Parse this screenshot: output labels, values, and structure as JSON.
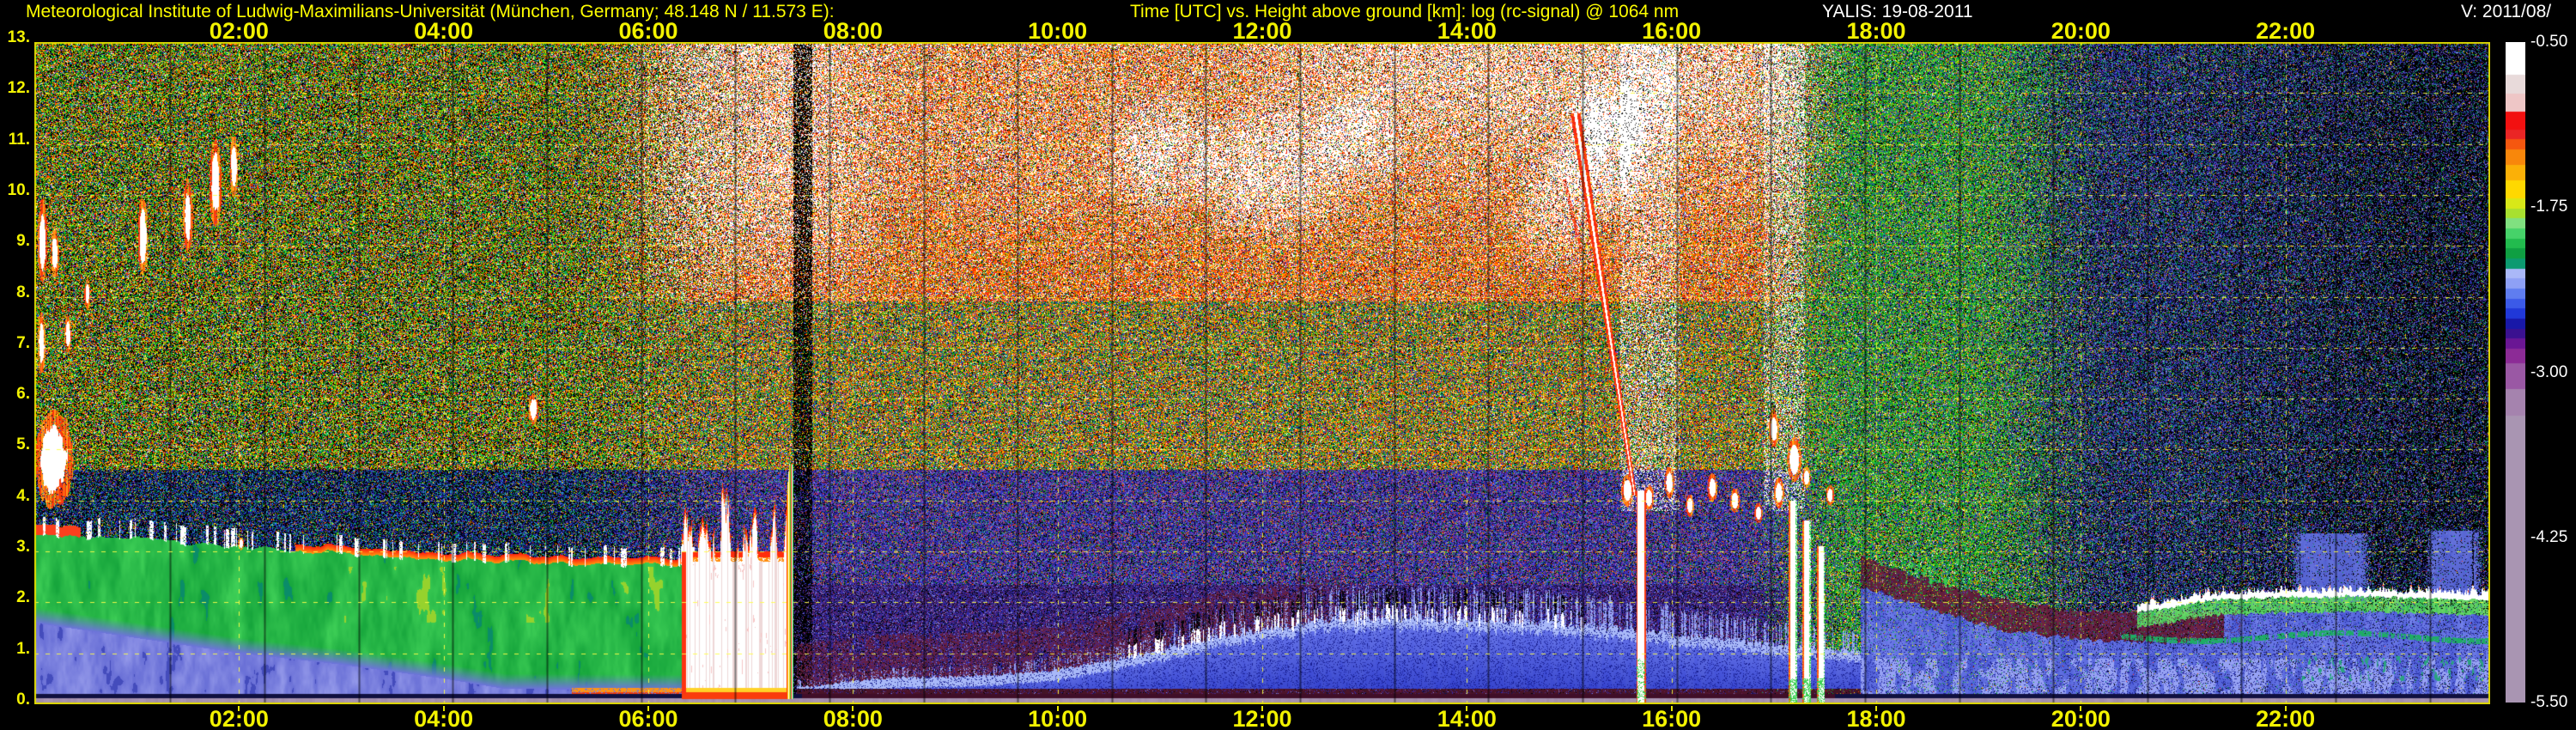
{
  "header": {
    "institute": "Meteorological Institute of Ludwig-Maximilians-Universität (München, Germany; 48.148 N / 11.573 E):",
    "plot_title": "Time [UTC] vs. Height above ground [km]: log (rc-signal) @ 1064 nm",
    "instrument_date": "YALIS: 19-08-2011",
    "version": "V: 2011/08/"
  },
  "axes": {
    "x_tick_hours": [
      2,
      4,
      6,
      8,
      10,
      12,
      14,
      16,
      18,
      20,
      22
    ],
    "x_tick_labels": [
      "02:00",
      "04:00",
      "06:00",
      "08:00",
      "10:00",
      "12:00",
      "14:00",
      "16:00",
      "18:00",
      "20:00",
      "22:00"
    ],
    "y_tick_km": [
      0,
      1,
      2,
      3,
      4,
      5,
      6,
      7,
      8,
      9,
      10,
      11,
      12,
      13
    ],
    "y_tick_labels": [
      "0.",
      "1.",
      "2.",
      "3.",
      "4.",
      "5.",
      "6.",
      "7.",
      "8.",
      "9.",
      "10.",
      "11.",
      "12.",
      "13."
    ]
  },
  "colorbar": {
    "labels": [
      "-0.50",
      "-1.75",
      "-3.00",
      "-4.25",
      "-5.50"
    ],
    "label_fracs": [
      0,
      0.25,
      0.5,
      0.75,
      1
    ],
    "segments": [
      [
        "#ffffff",
        70
      ],
      [
        "#e8dada",
        38
      ],
      [
        "#eec6c6",
        38
      ],
      [
        "#f21010",
        38
      ],
      [
        "#ea2525",
        21
      ],
      [
        "#f5570f",
        21
      ],
      [
        "#f8870b",
        32
      ],
      [
        "#fbb007",
        32
      ],
      [
        "#ffd800",
        38
      ],
      [
        "#d8e818",
        21
      ],
      [
        "#a8e030",
        21
      ],
      [
        "#80e080",
        21
      ],
      [
        "#46d269",
        21
      ],
      [
        "#22bb4e",
        21
      ],
      [
        "#0f9f42",
        21
      ],
      [
        "#0c9a70",
        21
      ],
      [
        "#aab8f8",
        21
      ],
      [
        "#8ea0f5",
        21
      ],
      [
        "#5f7df0",
        21
      ],
      [
        "#3b5ae8",
        21
      ],
      [
        "#2038d8",
        21
      ],
      [
        "#1818a8",
        21
      ],
      [
        "#3a1190",
        21
      ],
      [
        "#6a1694",
        21
      ],
      [
        "#8c2b96",
        30
      ],
      [
        "#9a58a4",
        55
      ],
      [
        "#a583ae",
        55
      ],
      [
        "#a995b2",
        600
      ]
    ]
  },
  "chart_data": {
    "type": "heatmap",
    "title": "Time [UTC] vs. Height above ground [km]: log (rc-signal) @ 1064 nm",
    "quantity": "log (rc-signal)",
    "wavelength_nm": 1064,
    "date": "19-08-2011",
    "instrument": "YALIS",
    "x_axis": {
      "label": "Time [UTC]",
      "range_hours": [
        0,
        24
      ]
    },
    "y_axis": {
      "label": "Height above ground [km]",
      "range_km": [
        0,
        13
      ]
    },
    "color_scale": {
      "top_value": -0.5,
      "bottom_value": -5.5,
      "tick_values": [
        -0.5,
        -1.75,
        -3.0,
        -4.25,
        -5.5
      ]
    },
    "phenomena": {
      "night_bl": {
        "t_end": 6.45,
        "green_top": [
          [
            0,
            3.35
          ],
          [
            1,
            3.25
          ],
          [
            2,
            3.08
          ],
          [
            3,
            2.95
          ],
          [
            4,
            2.85
          ],
          [
            5,
            2.78
          ],
          [
            6.45,
            2.72
          ]
        ],
        "green_bottom": [
          [
            0,
            1.6
          ],
          [
            1,
            1.3
          ],
          [
            2,
            1.0
          ],
          [
            3,
            0.78
          ],
          [
            4,
            0.5
          ],
          [
            4.6,
            0.3
          ],
          [
            6.45,
            0.28
          ]
        ]
      },
      "surface_red_line": [
        5.25,
        6.4
      ],
      "morning_cloud": {
        "t0": 6.33,
        "t1": 7.42,
        "base": 0.24,
        "top_mean": 3.0,
        "top_amp": 1.5
      },
      "gap": [
        7.42,
        7.6
      ],
      "day_bl": {
        "t0": 7.45,
        "t1": 18.1,
        "heights": [
          [
            7.6,
            0.35
          ],
          [
            8.2,
            0.5
          ],
          [
            9.2,
            0.55
          ],
          [
            10,
            0.68
          ],
          [
            10.6,
            0.88
          ],
          [
            11,
            1.05
          ],
          [
            11.6,
            1.35
          ],
          [
            12.6,
            1.65
          ],
          [
            13.6,
            1.7
          ],
          [
            14.6,
            1.62
          ],
          [
            15.5,
            1.48
          ],
          [
            16.5,
            1.28
          ],
          [
            17.3,
            1.12
          ],
          [
            18.1,
            1.0
          ]
        ],
        "caps": [
          10.6,
          15.25
        ],
        "residual_maroon_end": 13.2
      },
      "evening_band": {
        "t0": 17.85,
        "t1": 21.6,
        "halfwidth": 0.27,
        "center": [
          [
            17.85,
            2.6
          ],
          [
            18.6,
            2.1
          ],
          [
            19.3,
            1.72
          ],
          [
            20,
            1.55
          ],
          [
            20.8,
            1.5
          ],
          [
            21.6,
            1.55
          ]
        ]
      },
      "evening_green_blobs": [
        18.25,
        18.95,
        2.3,
        2.85
      ],
      "stratus": {
        "t0": 20.55,
        "base": [
          [
            20.55,
            1.8
          ],
          [
            21.3,
            2.05
          ],
          [
            22.5,
            2.12
          ],
          [
            24,
            2.05
          ]
        ]
      },
      "green_layer": {
        "t0": 20.4,
        "k": 1.32,
        "wobble": 0.08
      },
      "teal_wisps": {
        "t0": 22.1,
        "k0": 0.45,
        "k1": 0.95
      },
      "blue_patches": [
        [
          22.05,
          22.85,
          2.0,
          3.35
        ],
        [
          23.35,
          23.95,
          2.05,
          3.4
        ]
      ],
      "virga": {
        "k_top": 11.6,
        "k_bot": 4.1,
        "t_top": 15.06,
        "t_bot": 15.64,
        "column": [
          15.655,
          15.75,
          4.2
        ],
        "secondary": [
          [
            14.95,
            10.3
          ],
          [
            15.12,
            8.9
          ]
        ]
      },
      "rain_columns": [
        [
          17.14,
          17.23,
          4.0
        ],
        [
          17.28,
          17.36,
          3.6
        ],
        [
          17.42,
          17.5,
          3.1
        ]
      ],
      "cirrus_blobs": [
        [
          0.08,
          9.1,
          0.05,
          0.8
        ],
        [
          0.2,
          8.85,
          0.04,
          0.5
        ],
        [
          0.07,
          7.1,
          0.04,
          0.6
        ],
        [
          0.33,
          7.25,
          0.035,
          0.35
        ],
        [
          1.06,
          9.2,
          0.05,
          0.75
        ],
        [
          1.5,
          9.6,
          0.05,
          0.7
        ],
        [
          1.77,
          10.2,
          0.06,
          0.85
        ],
        [
          1.95,
          10.55,
          0.04,
          0.6
        ],
        [
          0.52,
          8.05,
          0.03,
          0.3
        ],
        [
          2.02,
          3.15,
          0.03,
          0.12
        ],
        [
          4.88,
          5.8,
          0.05,
          0.3
        ],
        [
          0.19,
          4.8,
          0.19,
          0.95
        ]
      ],
      "cu_blobs": [
        [
          15.57,
          4.2,
          0.06,
          0.32
        ],
        [
          15.78,
          4.05,
          0.05,
          0.25
        ],
        [
          15.98,
          4.35,
          0.05,
          0.3
        ],
        [
          16.18,
          3.9,
          0.04,
          0.22
        ],
        [
          16.4,
          4.25,
          0.05,
          0.28
        ],
        [
          16.62,
          4.0,
          0.05,
          0.24
        ],
        [
          16.85,
          3.75,
          0.04,
          0.2
        ],
        [
          17.05,
          4.15,
          0.05,
          0.3
        ],
        [
          17.2,
          4.8,
          0.07,
          0.45
        ],
        [
          17.0,
          5.4,
          0.05,
          0.35
        ],
        [
          17.32,
          4.45,
          0.04,
          0.22
        ],
        [
          17.55,
          4.1,
          0.04,
          0.2
        ]
      ],
      "midday_cirrus": [
        [
          11.0,
          10.8,
          0.7,
          1.3,
          0.5
        ],
        [
          12.1,
          10.4,
          0.85,
          1.5,
          0.55
        ],
        [
          12.95,
          11.0,
          0.5,
          1.1,
          0.45
        ],
        [
          14.9,
          9.7,
          0.5,
          1.4,
          0.5
        ],
        [
          15.35,
          10.9,
          0.5,
          1.6,
          0.65
        ]
      ],
      "white_columns": [
        [
          15.5,
          16.08
        ],
        [
          16.9,
          17.3
        ]
      ],
      "file_lines": {
        "start": 1.33,
        "step": 0.92
      },
      "palettes": {
        "night_high": [
          [
            "#10c020",
            30
          ],
          [
            "#ffd800",
            17
          ],
          [
            "#ff7700",
            14
          ],
          [
            "#ff2200",
            12
          ],
          [
            "#2244dd",
            10
          ],
          [
            "#00b8b8",
            5
          ],
          [
            "#ffffff",
            5
          ],
          [
            "#cc44cc",
            3
          ],
          [
            "#88ff00",
            4
          ]
        ],
        "night_low": [
          [
            "#2030c0",
            28
          ],
          [
            "#101080",
            16
          ],
          [
            "#10b030",
            16
          ],
          [
            "#6040b0",
            12
          ],
          [
            "#00a0a0",
            8
          ],
          [
            "#ffd800",
            6
          ],
          [
            "#ff3300",
            5
          ],
          [
            "#3399ff",
            9
          ]
        ],
        "day_high": [
          [
            "#ff6600",
            26
          ],
          [
            "#ff2200",
            20
          ],
          [
            "#ffffff",
            18
          ],
          [
            "#ffcc00",
            16
          ],
          [
            "#10a020",
            9
          ],
          [
            "#2233cc",
            6
          ],
          [
            "#883399",
            5
          ]
        ],
        "day_mid_high": [
          [
            "#ff7700",
            20
          ],
          [
            "#10a020",
            22
          ],
          [
            "#ffd800",
            16
          ],
          [
            "#ff2200",
            10
          ],
          [
            "#2233cc",
            12
          ],
          [
            "#ffffff",
            6
          ],
          [
            "#00b070",
            8
          ],
          [
            "#7733aa",
            6
          ]
        ],
        "day_mid": [
          [
            "#5c2a9c",
            26
          ],
          [
            "#2838cc",
            26
          ],
          [
            "#131372",
            14
          ],
          [
            "#10a030",
            9
          ],
          [
            "#7a86e8",
            12
          ],
          [
            "#ff3300",
            4
          ],
          [
            "#ff8800",
            4
          ],
          [
            "#b04090",
            5
          ]
        ],
        "day_low": [
          [
            "#4a2a88",
            34
          ],
          [
            "#2a2ab0",
            26
          ],
          [
            "#6a1a50",
            14
          ],
          [
            "#12124e",
            16
          ],
          [
            "#8888e0",
            10
          ]
        ],
        "evening": [
          [
            "#10b020",
            40
          ],
          [
            "#7fe030",
            12
          ],
          [
            "#ffd800",
            10
          ],
          [
            "#2a3ac0",
            12
          ],
          [
            "#00a880",
            8
          ],
          [
            "#ffffff",
            3
          ],
          [
            "#ff4400",
            5
          ],
          [
            "#6040b0",
            10
          ]
        ],
        "late_night": [
          [
            "#2a3ac8",
            26
          ],
          [
            "#6040b8",
            22
          ],
          [
            "#10a040",
            15
          ],
          [
            "#14145a",
            16
          ],
          [
            "#00a890",
            6
          ],
          [
            "#8890e8",
            8
          ],
          [
            "#ffd800",
            4
          ],
          [
            "#ff3322",
            3
          ]
        ]
      }
    }
  }
}
